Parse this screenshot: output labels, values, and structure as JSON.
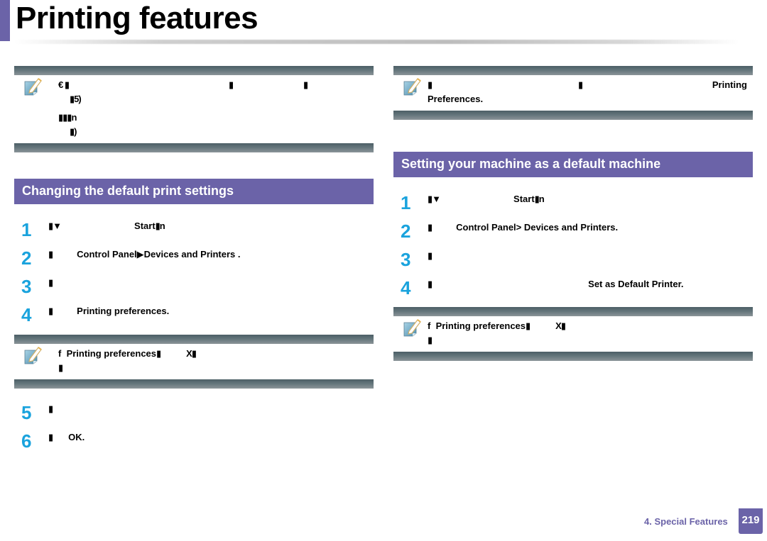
{
  "page": {
    "title": "Printing features",
    "accent_color": "#6b63a8",
    "step_number_color": "#1aa3dd"
  },
  "left": {
    "top_note": {
      "lines": [
        {
          "a": "€ ▮",
          "b1": "",
          "bold1": "▮",
          "bold2": "▮"
        },
        {
          "text": "▮5)"
        },
        {
          "text": "▮▮▮n"
        },
        {
          "text": "▮)"
        }
      ]
    },
    "section": {
      "title": "Changing the default print settings",
      "steps": [
        {
          "num": "1",
          "lead": "▮▼",
          "bold": "Start",
          "tail": "▮n"
        },
        {
          "num": "2",
          "lead": "▮",
          "bold": "Control Panel▶Devices and Printers",
          "tail": "  ."
        },
        {
          "num": "3",
          "lead": "▮",
          "bold": "",
          "tail": ""
        },
        {
          "num": "4",
          "lead": "▮",
          "bold": "Printing preferences.",
          "tail": ""
        }
      ],
      "note": {
        "line1_prefix": "f",
        "line1_bold": "Printing preferences",
        "line1_tail": "▮",
        "line1_end": "X▮",
        "line2": "▮"
      },
      "steps_after": [
        {
          "num": "5",
          "lead": "▮",
          "bold": "",
          "tail": ""
        },
        {
          "num": "6",
          "lead": "▮",
          "bold": "OK.",
          "tail": ""
        }
      ]
    }
  },
  "right": {
    "top_note": {
      "lead": "▮",
      "mid": "▮",
      "bold_end": "Printing",
      "line2_bold": "Preferences."
    },
    "section": {
      "title": "Setting your machine as a default machine",
      "steps": [
        {
          "num": "1",
          "lead": "▮▼",
          "bold": "Start",
          "tail": "▮n"
        },
        {
          "num": "2",
          "lead": "▮",
          "bold": "Control Panel>  Devices and Printers.",
          "tail": ""
        },
        {
          "num": "3",
          "lead": "▮",
          "bold": "",
          "tail": ""
        },
        {
          "num": "4",
          "lead": "▮",
          "bold": "Set as Default Printer.",
          "tail": ""
        }
      ],
      "note": {
        "line1_prefix": "f",
        "line1_bold": "Printing preferences",
        "line1_tail": "▮",
        "line1_end": "X▮",
        "line2": "▮"
      }
    }
  },
  "footer": {
    "chapter": "4.  Special Features",
    "page_number": "219"
  }
}
